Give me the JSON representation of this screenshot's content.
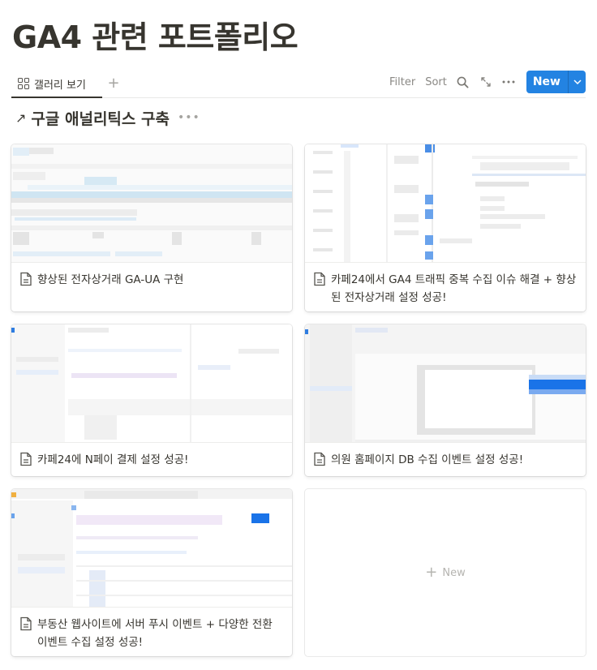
{
  "page": {
    "title": "GA4 관련 포트폴리오"
  },
  "view_bar": {
    "active_view": {
      "label": "갤러리 보기",
      "icon": "gallery-icon"
    },
    "add_view_icon": "plus-icon",
    "filter_label": "Filter",
    "sort_label": "Sort",
    "search_icon": "search-icon",
    "expand_icon": "expand-icon",
    "more_icon": "more-horizontal-icon",
    "new_button": {
      "label": "New",
      "dropdown_icon": "chevron-down-icon"
    }
  },
  "group": {
    "arrow_icon": "arrow-up-right-icon",
    "title": "구글 애널리틱스 구축",
    "more_label": "•••"
  },
  "cards": [
    {
      "title": "향상된 전자상거래 GA-UA 구현",
      "icon": "document-icon"
    },
    {
      "title": "카페24에서 GA4 트래픽 중복 수집 이슈 해결 + 향상된 전자상거래 설정 성공!",
      "icon": "document-icon"
    },
    {
      "title": "카페24에 N페이 결제 설정 성공!",
      "icon": "document-icon"
    },
    {
      "title": "의원 홈페이지 DB 수집 이벤트 설정 성공!",
      "icon": "document-icon"
    },
    {
      "title": "부동산 웹사이트에 서버 푸시 이벤트 + 다양한 전환 이벤트 수집 설정 성공!",
      "icon": "document-icon"
    }
  ],
  "new_card": {
    "label": "New",
    "icon": "plus-icon"
  },
  "colors": {
    "accent": "#2383e2",
    "text": "#37352f",
    "muted": "#8a8884"
  }
}
